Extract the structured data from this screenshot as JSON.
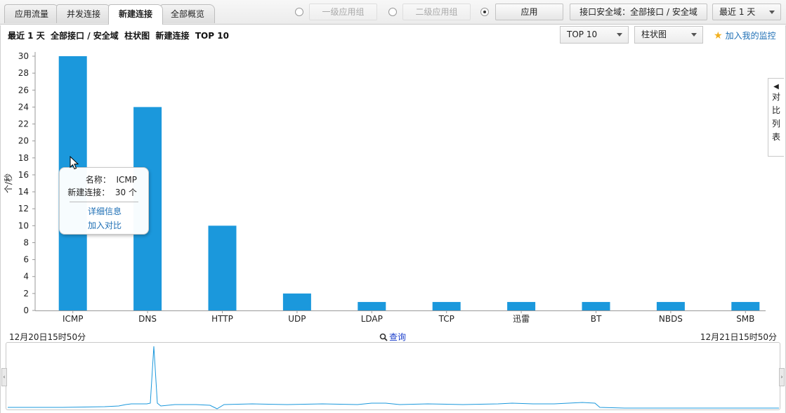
{
  "tabs": [
    "应用流量",
    "并发连接",
    "新建连接",
    "全部概览"
  ],
  "active_tab": 2,
  "toolbar": {
    "level1_group": "一级应用组",
    "level2_group": "二级应用组",
    "apply_label": "应用",
    "scope_label": "接口安全域：全部接口 / 安全域",
    "range_label": "最近 1 天",
    "selected_radio": 2
  },
  "subtitle": "最近 1 天  全部接口 / 安全域  柱状图  新建连接  TOP 10",
  "selects": {
    "top_n": "TOP 10",
    "chart_type": "柱状图"
  },
  "add_monitor": "加入我的监控",
  "side_panel": {
    "label_chars": [
      "对",
      "比",
      "列",
      "表"
    ]
  },
  "tooltip": {
    "name_line": "名称：  ICMP",
    "value_line": "新建连接：  30 个",
    "detail_link": "详细信息",
    "compare_link": "加入对比"
  },
  "overview": {
    "start": "12月20日15时50分",
    "end": "12月21日15时50分",
    "query_label": "查询"
  },
  "colors": {
    "bar": "#1b98dc",
    "link": "#1e6fb5",
    "line": "#1b98dc"
  },
  "chart_data": {
    "type": "bar",
    "categories": [
      "ICMP",
      "DNS",
      "HTTP",
      "UDP",
      "LDAP",
      "TCP",
      "迅雷",
      "BT",
      "NBDS",
      "SMB"
    ],
    "values": [
      30,
      24,
      10,
      2,
      1,
      1,
      1,
      1,
      1,
      1
    ],
    "ylabel": "个/秒",
    "ylim": [
      0,
      30
    ],
    "yticks": [
      0,
      2,
      4,
      6,
      8,
      10,
      12,
      14,
      16,
      18,
      20,
      22,
      24,
      26,
      28,
      30
    ],
    "grid": false,
    "legend": "none"
  }
}
